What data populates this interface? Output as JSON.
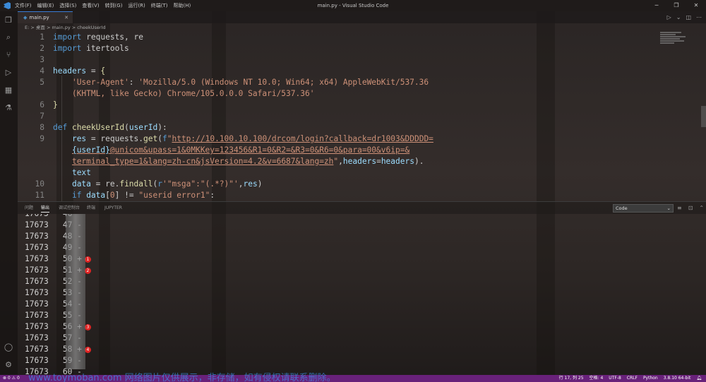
{
  "window": {
    "title": "main.py - Visual Studio Code",
    "menu": [
      "文件(F)",
      "编辑(E)",
      "选择(S)",
      "查看(V)",
      "转到(G)",
      "运行(R)",
      "终端(T)",
      "帮助(H)"
    ],
    "controls": [
      "─",
      "❐",
      "✕"
    ]
  },
  "tab": {
    "label": "main.py",
    "close": "✕"
  },
  "breadcrumb": "E: > 桌面 > main.py > cheekUserId",
  "code_lines": [
    {
      "n": "1",
      "t": "import requests, re"
    },
    {
      "n": "2",
      "t": "import itertools"
    },
    {
      "n": "3",
      "t": ""
    },
    {
      "n": "4",
      "t": "headers = {"
    },
    {
      "n": "5",
      "t": "    'User-Agent': 'Mozilla/5.0 (Windows NT 10.0; Win64; x64) AppleWebKit/537.36"
    },
    {
      "n": "",
      "t": "    (KHTML, like Gecko) Chrome/105.0.0.0 Safari/537.36'"
    },
    {
      "n": "6",
      "t": "}"
    },
    {
      "n": "7",
      "t": ""
    },
    {
      "n": "8",
      "t": "def cheekUserId(userId):"
    },
    {
      "n": "9",
      "t": "    res = requests.get(f\"http://10.100.10.100/drcom/login?callback=dr1003&DDDDD="
    },
    {
      "n": "",
      "t": "    {userId}@unicom&upass=1&0MKKey=123456&R1=0&R2=&R3=0&R6=0&para=00&v6ip=&"
    },
    {
      "n": "",
      "t": "    terminal_type=1&lang=zh-cn&jsVersion=4.2&v=6687&lang=zh\",headers=headers)."
    },
    {
      "n": "",
      "t": "    text"
    },
    {
      "n": "10",
      "t": "    data = re.findall(r'\"msga\":\"(.*?)\"',res)"
    },
    {
      "n": "11",
      "t": "    if data[0] != \"userid error1\":"
    }
  ],
  "panel": {
    "tabs": [
      "问题",
      "输出",
      "调试控制台",
      "终端",
      "JUPYTER"
    ],
    "active_tab": "输出",
    "channel": "Code"
  },
  "output_rows": [
    {
      "pre": "17673",
      "suf": "46",
      "mark": "",
      "badge": ""
    },
    {
      "pre": "17673",
      "suf": "47",
      "mark": "-",
      "badge": ""
    },
    {
      "pre": "17673",
      "suf": "48",
      "mark": "-",
      "badge": ""
    },
    {
      "pre": "17673",
      "suf": "49",
      "mark": "-",
      "badge": ""
    },
    {
      "pre": "17673",
      "suf": "50",
      "mark": "+",
      "badge": "1"
    },
    {
      "pre": "17673",
      "suf": "51",
      "mark": "+",
      "badge": "2"
    },
    {
      "pre": "17673",
      "suf": "52",
      "mark": "-",
      "badge": ""
    },
    {
      "pre": "17673",
      "suf": "53",
      "mark": "-",
      "badge": ""
    },
    {
      "pre": "17673",
      "suf": "54",
      "mark": "-",
      "badge": ""
    },
    {
      "pre": "17673",
      "suf": "55",
      "mark": "-",
      "badge": ""
    },
    {
      "pre": "17673",
      "suf": "56",
      "mark": "+",
      "badge": "3"
    },
    {
      "pre": "17673",
      "suf": "57",
      "mark": "-",
      "badge": ""
    },
    {
      "pre": "17673",
      "suf": "58",
      "mark": "+",
      "badge": "4"
    },
    {
      "pre": "17673",
      "suf": "59",
      "mark": "-",
      "badge": ""
    },
    {
      "pre": "17673",
      "suf": "60",
      "mark": "-",
      "badge": ""
    }
  ],
  "status": {
    "left": "⊗ 0 ⚠ 0",
    "position": "行 17, 列 25",
    "spaces": "空格: 4",
    "encoding": "UTF-8",
    "eol": "CRLF",
    "language": "Python",
    "interpreter": "3.8.10 64-bit",
    "color": "#68217a"
  },
  "watermark": "www.toymoban.com 网络图片仅供展示，非存储，如有侵权请联系删除。"
}
